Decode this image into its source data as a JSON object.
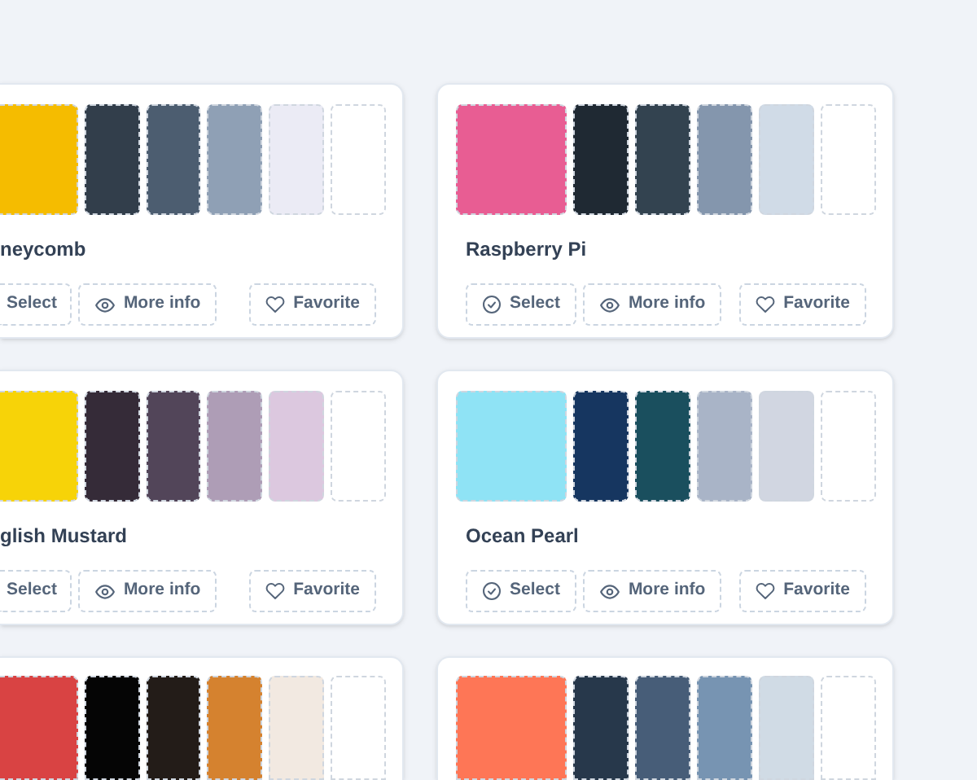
{
  "palettes": [
    {
      "cut_left": true,
      "name": "neycomb",
      "swatches": [
        {
          "color": "#f5bc00"
        },
        {
          "color": "#323e4b"
        },
        {
          "color": "#4c5d70"
        },
        {
          "color": "#8fa0b5"
        },
        {
          "color": "#ebebf5"
        },
        {
          "color": "#ffffff"
        }
      ],
      "buttons": [
        {
          "kind": "select",
          "label": "Select"
        },
        {
          "kind": "info",
          "label": "More info"
        },
        {
          "kind": "favorite",
          "label": "Favorite"
        }
      ]
    },
    {
      "cut_left": false,
      "name": "Raspberry Pi",
      "swatches": [
        {
          "color": "#e85d93"
        },
        {
          "color": "#1f2933"
        },
        {
          "color": "#334350"
        },
        {
          "color": "#8496ad"
        },
        {
          "color": "#d0dbe7"
        },
        {
          "color": "#ffffff"
        }
      ],
      "buttons": [
        {
          "kind": "select",
          "label": "Select"
        },
        {
          "kind": "info",
          "label": "More info"
        },
        {
          "kind": "favorite",
          "label": "Favorite"
        }
      ]
    },
    {
      "cut_left": true,
      "name": "glish Mustard",
      "swatches": [
        {
          "color": "#f7d308"
        },
        {
          "color": "#352b38"
        },
        {
          "color": "#524559"
        },
        {
          "color": "#ae9db6"
        },
        {
          "color": "#dcc8df"
        },
        {
          "color": "#ffffff"
        }
      ],
      "buttons": [
        {
          "kind": "select",
          "label": "Select"
        },
        {
          "kind": "info",
          "label": "More info"
        },
        {
          "kind": "favorite",
          "label": "Favorite"
        }
      ]
    },
    {
      "cut_left": false,
      "name": "Ocean Pearl",
      "swatches": [
        {
          "color": "#8fe3f5"
        },
        {
          "color": "#163660"
        },
        {
          "color": "#1a4f5e"
        },
        {
          "color": "#a9b4c7"
        },
        {
          "color": "#d1d6e1"
        },
        {
          "color": "#ffffff"
        }
      ],
      "buttons": [
        {
          "kind": "select",
          "label": "Select"
        },
        {
          "kind": "info",
          "label": "More info"
        },
        {
          "kind": "favorite",
          "label": "Favorite"
        }
      ]
    },
    {
      "cut_left": true,
      "swatches": [
        {
          "color": "#d94343"
        },
        {
          "color": "#050505"
        },
        {
          "color": "#231c18"
        },
        {
          "color": "#d5822f"
        },
        {
          "color": "#f2e9e1"
        },
        {
          "color": "#ffffff"
        }
      ]
    },
    {
      "cut_left": false,
      "swatches": [
        {
          "color": "#fe7656"
        },
        {
          "color": "#27384b"
        },
        {
          "color": "#475d78"
        },
        {
          "color": "#7794b2"
        },
        {
          "color": "#d0dbe5"
        },
        {
          "color": "#ffffff"
        }
      ]
    }
  ]
}
